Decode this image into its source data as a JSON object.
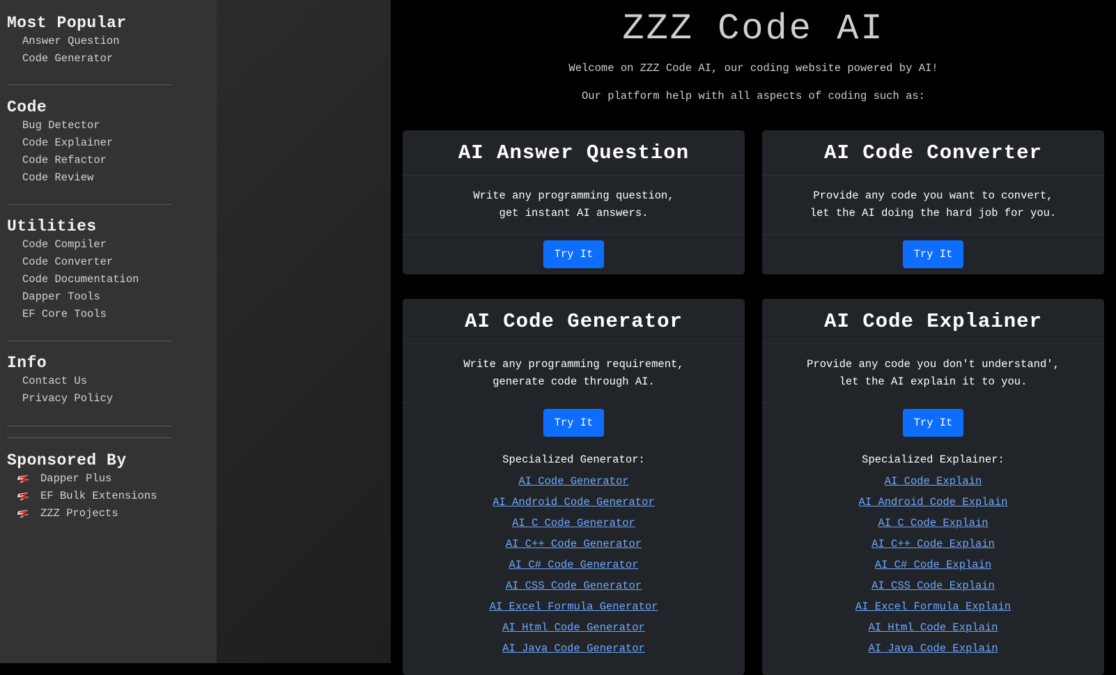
{
  "sidebar": {
    "sections": [
      {
        "heading": "Most Popular",
        "links": [
          "Answer Question",
          "Code Generator"
        ]
      },
      {
        "heading": "Code",
        "links": [
          "Bug Detector",
          "Code Explainer",
          "Code Refactor",
          "Code Review"
        ]
      },
      {
        "heading": "Utilities",
        "links": [
          "Code Compiler",
          "Code Converter",
          "Code Documentation",
          "Dapper Tools",
          "EF Core Tools"
        ]
      },
      {
        "heading": "Info",
        "links": [
          "Contact Us",
          "Privacy Policy"
        ]
      }
    ],
    "sponsored": {
      "heading": "Sponsored By",
      "items": [
        "Dapper Plus",
        "EF Bulk Extensions",
        "ZZZ Projects"
      ]
    }
  },
  "main": {
    "title": "ZZZ Code AI",
    "intro1": "Welcome on ZZZ Code AI, our coding website powered by AI!",
    "intro2": "Our platform help with all aspects of coding such as:",
    "cards": [
      {
        "title": "AI Answer Question",
        "line1": "Write any programming question,",
        "line2": "get instant AI answers.",
        "button": "Try It"
      },
      {
        "title": "AI Code Converter",
        "line1": "Provide any code you want to convert,",
        "line2": "let the AI doing the hard job for you.",
        "button": "Try It"
      },
      {
        "title": "AI Code Generator",
        "line1": "Write any programming requirement,",
        "line2": "generate code through AI.",
        "button": "Try It",
        "spec_title": "Specialized Generator:",
        "spec_links": [
          "AI Code Generator",
          "AI Android Code Generator",
          "AI C Code Generator",
          "AI C++ Code Generator",
          "AI C# Code Generator",
          "AI CSS Code Generator",
          "AI Excel Formula Generator",
          "AI Html Code Generator",
          "AI Java Code Generator"
        ]
      },
      {
        "title": "AI Code Explainer",
        "line1": "Provide any code you don't understand',",
        "line2": "let the AI explain it to you.",
        "button": "Try It",
        "spec_title": "Specialized Explainer:",
        "spec_links": [
          "AI Code Explain",
          "AI Android Code Explain",
          "AI C Code Explain",
          "AI C++ Code Explain",
          "AI C# Code Explain",
          "AI CSS Code Explain",
          "AI Excel Formula Explain",
          "AI Html Code Explain",
          "AI Java Code Explain"
        ]
      }
    ]
  },
  "colors": {
    "sidebar_bg": "#333333",
    "main_bg": "#000000",
    "card_bg": "#212529",
    "button": "#0d6efd",
    "link": "#6ea8fe"
  },
  "icons": {
    "sponsor": "zzz-logo-icon"
  }
}
